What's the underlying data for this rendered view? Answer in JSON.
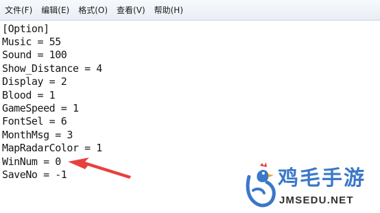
{
  "menu": [
    "文件(F)",
    "编辑(E)",
    "格式(O)",
    "查看(V)",
    "帮助(H)"
  ],
  "lines": [
    "[Option]",
    "Music = 55",
    "Sound = 100",
    "Show_Distance = 4",
    "Display = 2",
    "Blood = 1",
    "GameSpeed = 1",
    "FontSel = 6",
    "MonthMsg = 3",
    "MapRadarColor = 1",
    "WinNum = 0",
    "SaveNo = -1"
  ],
  "annotation": {
    "color": "#e8413c",
    "target_line": "WinNum = 0"
  },
  "watermark": {
    "title": "鸡毛手游",
    "url": "JMSEDU.NET",
    "color": "#3a78c9"
  }
}
